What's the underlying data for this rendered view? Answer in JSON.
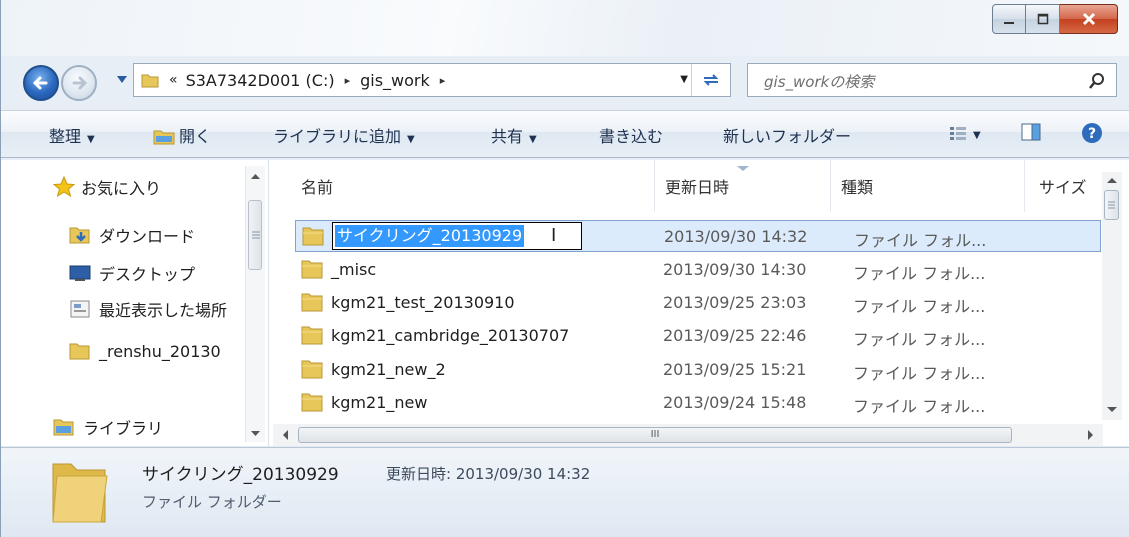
{
  "window": {
    "caption_buttons": [
      {
        "name": "minimize-button",
        "glyph": "—"
      },
      {
        "name": "maximize-button",
        "glyph": "□"
      },
      {
        "name": "close-button",
        "glyph": "X"
      }
    ]
  },
  "address": {
    "overflow": "«",
    "drive": "S3A7342D001 (C:)",
    "folder": "gis_work",
    "separator": "▸"
  },
  "search": {
    "placeholder": "gis_workの検索"
  },
  "toolbar": {
    "organize": "整理",
    "open": "開く",
    "add_to_library": "ライブラリに追加",
    "share": "共有",
    "burn": "書き込む",
    "new_folder": "新しいフォルダー",
    "dropdown_glyph": "▼"
  },
  "sidebar": {
    "favorites": "お気に入り",
    "downloads": "ダウンロード",
    "desktop": "デスクトップ",
    "recent": "最近表示した場所",
    "renshu": "_renshu_20130",
    "libraries": "ライブラリ"
  },
  "columns": {
    "name": "名前",
    "modified": "更新日時",
    "type": "種類",
    "size": "サイズ"
  },
  "files": [
    {
      "name": "サイクリング_20130929",
      "modified": "2013/09/30 14:32",
      "type": "ファイル フォル..."
    },
    {
      "name": "_misc",
      "modified": "2013/09/30 14:30",
      "type": "ファイル フォル..."
    },
    {
      "name": "kgm21_test_20130910",
      "modified": "2013/09/25 23:03",
      "type": "ファイル フォル..."
    },
    {
      "name": "kgm21_cambridge_20130707",
      "modified": "2013/09/25 22:46",
      "type": "ファイル フォル..."
    },
    {
      "name": "kgm21_new_2",
      "modified": "2013/09/25 15:21",
      "type": "ファイル フォル..."
    },
    {
      "name": "kgm21_new",
      "modified": "2013/09/24 15:48",
      "type": "ファイル フォル..."
    }
  ],
  "details": {
    "name": "サイクリング_20130929",
    "modified_label": "更新日時: 2013/09/30 14:32",
    "type": "ファイル フォルダー"
  },
  "scrollbar": {
    "grip": "III"
  },
  "colors": {
    "selection": "#3399ff",
    "selected_row": "#dcebfc",
    "folder": "#e8c75a"
  }
}
